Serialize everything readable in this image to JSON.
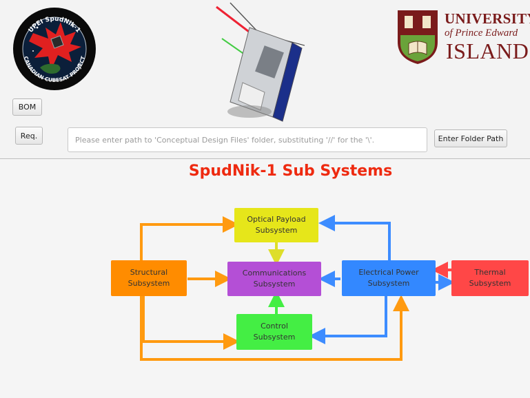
{
  "logo": {
    "top_text": "UPEI SpudNik-1",
    "bottom_text": "CANADIAN CUBESAT PROJECT"
  },
  "university": {
    "line1": "UNIVERSITY",
    "line2": "of Prince Edward",
    "line3": "ISLAND"
  },
  "toolbar": {
    "bom_label": "BOM",
    "req_label": "Req.",
    "path_placeholder": "Please enter path to 'Conceptual Design Files' folder, substituting '//' for the '\\'.",
    "enter_label": "Enter Folder Path"
  },
  "diagram": {
    "title": "SpudNik-1 Sub Systems",
    "subsystems": {
      "optical": {
        "line1": "Optical Payload",
        "line2": "Subsystem",
        "color": "#e6e61a"
      },
      "structural": {
        "line1": "Structural",
        "line2": "Subsystem",
        "color": "#ff8c00"
      },
      "communications": {
        "line1": "Communications",
        "line2": "Subsystem",
        "color": "#b44fd6"
      },
      "electrical": {
        "line1": "Electrical Power",
        "line2": "Subsystem",
        "color": "#3388ff"
      },
      "thermal": {
        "line1": "Thermal",
        "line2": "Subsystem",
        "color": "#ff4747"
      },
      "control": {
        "line1": "Control",
        "line2": "Subsystem",
        "color": "#44ee44"
      }
    }
  }
}
